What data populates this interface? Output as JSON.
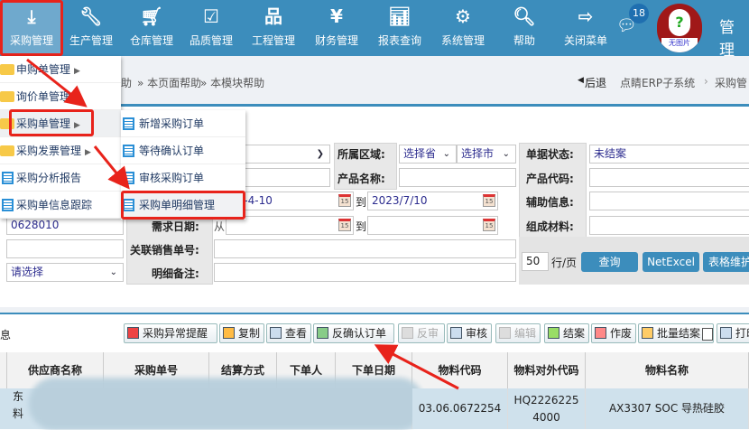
{
  "nav": {
    "items": [
      {
        "label": "采购管理",
        "icon": "download-tray-icon"
      },
      {
        "label": "生产管理",
        "icon": "wrench-icon"
      },
      {
        "label": "仓库管理",
        "icon": "cart-icon"
      },
      {
        "label": "品质管理",
        "icon": "checkbox-icon"
      },
      {
        "label": "工程管理",
        "icon": "org-chart-icon"
      },
      {
        "label": "财务管理",
        "icon": "yen-icon"
      },
      {
        "label": "报表查询",
        "icon": "bar-chart-icon"
      },
      {
        "label": "系统管理",
        "icon": "gear-icon"
      },
      {
        "label": "帮助",
        "icon": "search-icon"
      },
      {
        "label": "关闭菜单",
        "icon": "exit-icon"
      }
    ],
    "badge": "18",
    "avatar_text": "无图片",
    "user": "管理"
  },
  "breadcrumb": {
    "help": "助",
    "page_help": "» 本页面帮助",
    "module_help": "» 本模块帮助",
    "back": "后退",
    "path1": "点睛ERP子系统",
    "sep": "›",
    "path2": "采购管"
  },
  "menu": {
    "items": [
      {
        "label": "申购单管理",
        "type": "folder"
      },
      {
        "label": "询价单管理",
        "type": "folder"
      },
      {
        "label": "采购单管理",
        "type": "folder"
      },
      {
        "label": "采购发票管理",
        "type": "folder"
      },
      {
        "label": "采购分析报告",
        "type": "doc"
      },
      {
        "label": "采购单信息跟踪",
        "type": "doc"
      }
    ],
    "submenu": [
      {
        "label": "新增采购订单"
      },
      {
        "label": "等待确认订单"
      },
      {
        "label": "审核采购订单"
      },
      {
        "label": "采购单明细管理"
      }
    ]
  },
  "form": {
    "region_label": "所属区域:",
    "province": "选择省",
    "city": "选择市",
    "status_label": "单据状态:",
    "status": "未结案",
    "product_name_label": "产品名称:",
    "product_code_label": "产品代码:",
    "date_from": "23-4-10",
    "to": "到",
    "date_to": "2023/7/10",
    "aux_label": "辅助信息:",
    "code_value": "0628010",
    "need_date_label": "需求日期:",
    "from": "从",
    "material_label": "组成材料:",
    "sales_no_label": "关联销售单号:",
    "detail_note_label": "明细备注:",
    "select_placeholder": "请选择",
    "page_size": "50",
    "per_page": "行/页",
    "query": "查询",
    "netexcel": "NetExcel",
    "table_maint": "表格维护"
  },
  "toolbar": {
    "left_text": "息",
    "buttons": [
      {
        "label": "采购异常提醒",
        "enabled": true
      },
      {
        "label": "复制",
        "enabled": true
      },
      {
        "label": "查看",
        "enabled": true
      },
      {
        "label": "反确认订单",
        "enabled": true
      },
      {
        "label": "反审",
        "enabled": false
      },
      {
        "label": "审核",
        "enabled": true
      },
      {
        "label": "编辑",
        "enabled": false
      },
      {
        "label": "结案",
        "enabled": true
      },
      {
        "label": "作废",
        "enabled": true
      },
      {
        "label": "批量结案",
        "enabled": true
      },
      {
        "label": "打印",
        "enabled": true
      }
    ]
  },
  "table": {
    "headers": [
      "供应商名称",
      "采购单号",
      "结算方式",
      "下单人",
      "下单日期",
      "物料代码",
      "物料对外代码",
      "物料名称"
    ],
    "row": {
      "supplier": "东",
      "supplier2": "料",
      "material_code": "03.06.0672254",
      "external_code": "HQ2226225 4000",
      "material_name": "AX3307 SOC 导热硅胶"
    }
  }
}
